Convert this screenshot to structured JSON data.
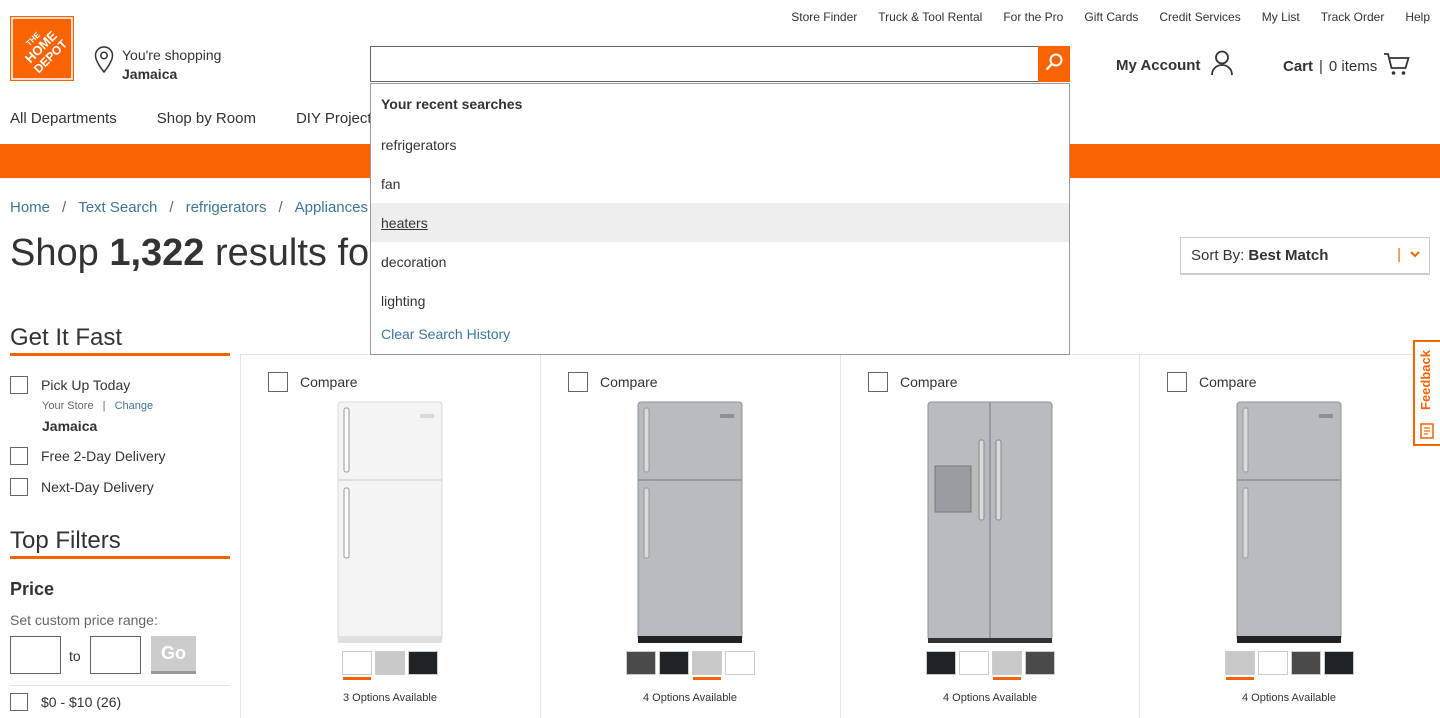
{
  "header": {
    "logo_text": "THE HOME DEPOT",
    "util_nav": [
      "Store Finder",
      "Truck & Tool Rental",
      "For the Pro",
      "Gift Cards",
      "Credit Services",
      "My List",
      "Track Order",
      "Help"
    ],
    "shopping_label": "You're shopping",
    "store_name": "Jamaica",
    "search_value": "",
    "account_label": "My Account",
    "cart_label": "Cart",
    "cart_count": "0 items",
    "main_nav": [
      "All Departments",
      "Shop by Room",
      "DIY Projects"
    ]
  },
  "breadcrumb": [
    "Home",
    "Text Search",
    "refrigerators",
    "Appliances"
  ],
  "title": {
    "prefix": "Shop",
    "count": "1,322",
    "suffix": "results for"
  },
  "sort": {
    "label": "Sort By:",
    "value": "Best Match"
  },
  "sidebar": {
    "get_it_fast": "Get It Fast",
    "pickup": "Pick Up Today",
    "your_store": "Your Store",
    "change": "Change",
    "store": "Jamaica",
    "free_2day": "Free 2-Day Delivery",
    "next_day": "Next-Day Delivery",
    "top_filters": "Top Filters",
    "price": "Price",
    "custom_range": "Set custom price range:",
    "to": "to",
    "go": "Go",
    "range_1": "$0 - $10 (26)"
  },
  "products": [
    {
      "compare": "Compare",
      "options": "3 Options Available",
      "style": "white",
      "swatches": [
        "#ffffff",
        "#c8c8c8",
        "#1f2326"
      ],
      "selected": 0
    },
    {
      "compare": "Compare",
      "options": "4 Options Available",
      "style": "steel",
      "swatches": [
        "#4a4a4a",
        "#1f2326",
        "#c8c8c8",
        "#ffffff"
      ],
      "selected": 2
    },
    {
      "compare": "Compare",
      "options": "4 Options Available",
      "style": "sxs",
      "swatches": [
        "#1f2326",
        "#ffffff",
        "#c8c8c8",
        "#4a4a4a"
      ],
      "selected": 2
    },
    {
      "compare": "Compare",
      "options": "4 Options Available",
      "style": "steel",
      "swatches": [
        "#c8c8c8",
        "#ffffff",
        "#4a4a4a",
        "#1f2326"
      ],
      "selected": 0
    }
  ],
  "feedback": "Feedback",
  "dropdown": {
    "title": "Your recent searches",
    "items": [
      "refrigerators",
      "fan",
      "heaters",
      "decoration",
      "lighting"
    ],
    "highlighted": 2,
    "clear": "Clear Search History"
  },
  "colors": {
    "brand": "#f96302",
    "link": "#3e7697"
  }
}
